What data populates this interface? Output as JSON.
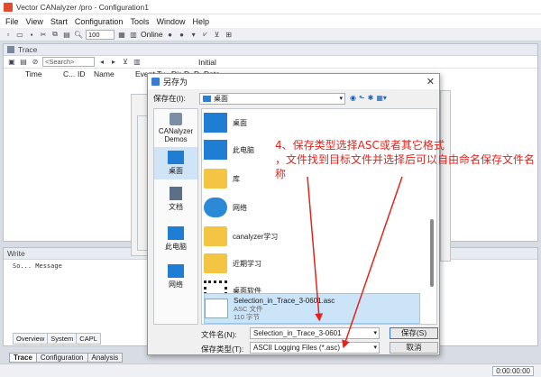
{
  "app": {
    "title": "Vector CANalyzer /pro - Configuration1",
    "menu": [
      "File",
      "View",
      "Start",
      "Configuration",
      "Tools",
      "Window",
      "Help"
    ],
    "zoom": "100",
    "online_label": "Online"
  },
  "trace": {
    "title": "Trace",
    "search_placeholder": "<Search>",
    "initial_label": "Initial",
    "columns": [
      "Time",
      "C...",
      "ID",
      "Name",
      "Event Ty...",
      "Dir",
      "D...",
      "D...",
      "Data"
    ]
  },
  "write": {
    "title": "Write",
    "columns": "So...   Message",
    "tabs": [
      "Overview",
      "System",
      "CAPL"
    ]
  },
  "bottom_tabs": [
    "Trace",
    "Configuration",
    "Analysis"
  ],
  "status": {
    "time": "0:00:00:00"
  },
  "dialog": {
    "title": "另存为",
    "save_in_label": "保存在(I):",
    "save_in_value": "桌面",
    "places": [
      {
        "label": "CANalyzer Demos"
      },
      {
        "label": "桌面"
      },
      {
        "label": "文档"
      },
      {
        "label": "此电脑"
      },
      {
        "label": "网络"
      }
    ],
    "files": [
      {
        "name": "桌面"
      },
      {
        "name": "此电脑"
      },
      {
        "name": "库"
      },
      {
        "name": "网络"
      },
      {
        "name": "canalyzer学习"
      },
      {
        "name": "近期学习"
      },
      {
        "name": "桌面软件"
      }
    ],
    "selected_file": {
      "name": "Selection_in_Trace_3-0601.asc",
      "type": "ASC 文件",
      "size": "110 字节"
    },
    "filename_label": "文件名(N):",
    "filename_value": "Selection_in_Trace_3-0601",
    "filetype_label": "保存类型(T):",
    "filetype_value": "ASCII Logging Files (*.asc)",
    "save_button": "保存(S)",
    "cancel_button": "取消"
  },
  "annotation": {
    "line1": "4、保存类型选择ASC或者其它格式",
    "line2": "，文件找到目标文件并选择后可以自由命名保存文件名称"
  },
  "colors": {
    "annotation": "#e5231b",
    "selection": "#cce4f7",
    "folder": "#f4c542"
  }
}
